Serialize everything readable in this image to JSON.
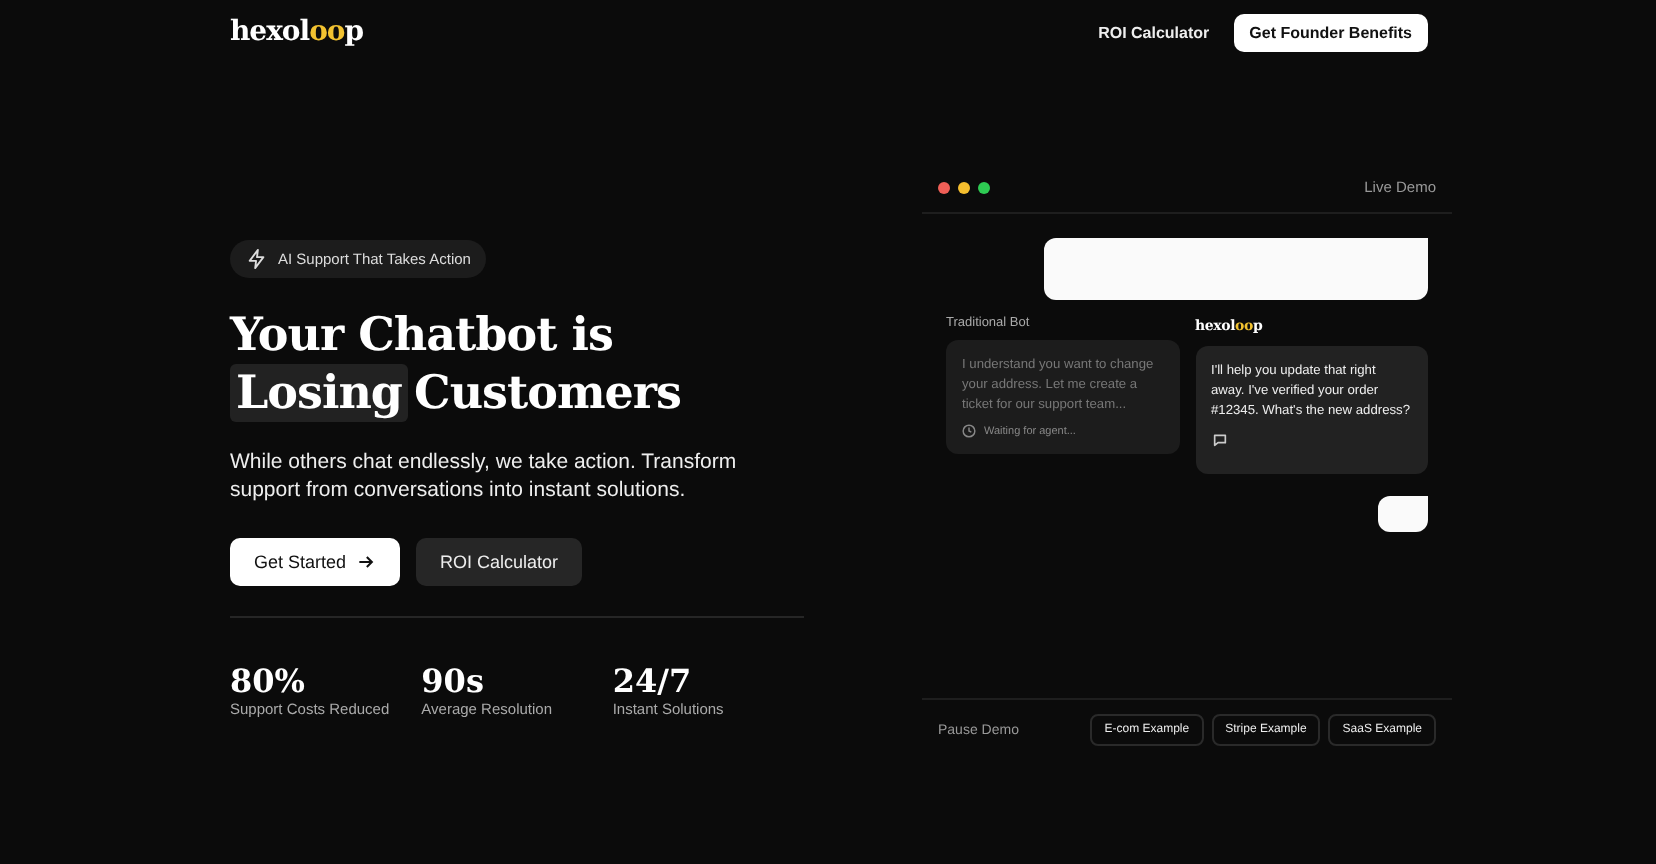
{
  "header": {
    "logo": {
      "start": "hexol",
      "accent": "oo",
      "end": "p"
    },
    "nav_link": "ROI Calculator",
    "cta": "Get Founder Benefits"
  },
  "hero": {
    "badge": "AI Support That Takes Action",
    "title_line1": "Your Chatbot is",
    "title_highlight": "Losing",
    "title_rest": "Customers",
    "subtitle": "While others chat endlessly, we take action. Transform support from conversations into instant solutions.",
    "primary_button": "Get Started",
    "secondary_button": "ROI Calculator",
    "stats": [
      {
        "value": "80%",
        "label": "Support Costs Reduced"
      },
      {
        "value": "90s",
        "label": "Average Resolution"
      },
      {
        "value": "24/7",
        "label": "Instant Solutions"
      }
    ]
  },
  "demo": {
    "title": "Live Demo",
    "traditional": {
      "label": "Traditional Bot",
      "message": "I understand you want to change your address. Let me create a ticket for our support team...",
      "status": "Waiting for agent..."
    },
    "hexoloop": {
      "logo": {
        "start": "hexol",
        "accent": "oo",
        "end": "p"
      },
      "message": "I'll help you update that right away. I've verified your order #12345. What's the new address?"
    },
    "pause": "Pause Demo",
    "examples": [
      {
        "label": "E-com Example",
        "selected": false
      },
      {
        "label": "Stripe Example",
        "selected": false
      },
      {
        "label": "SaaS Example",
        "selected": false
      }
    ]
  }
}
